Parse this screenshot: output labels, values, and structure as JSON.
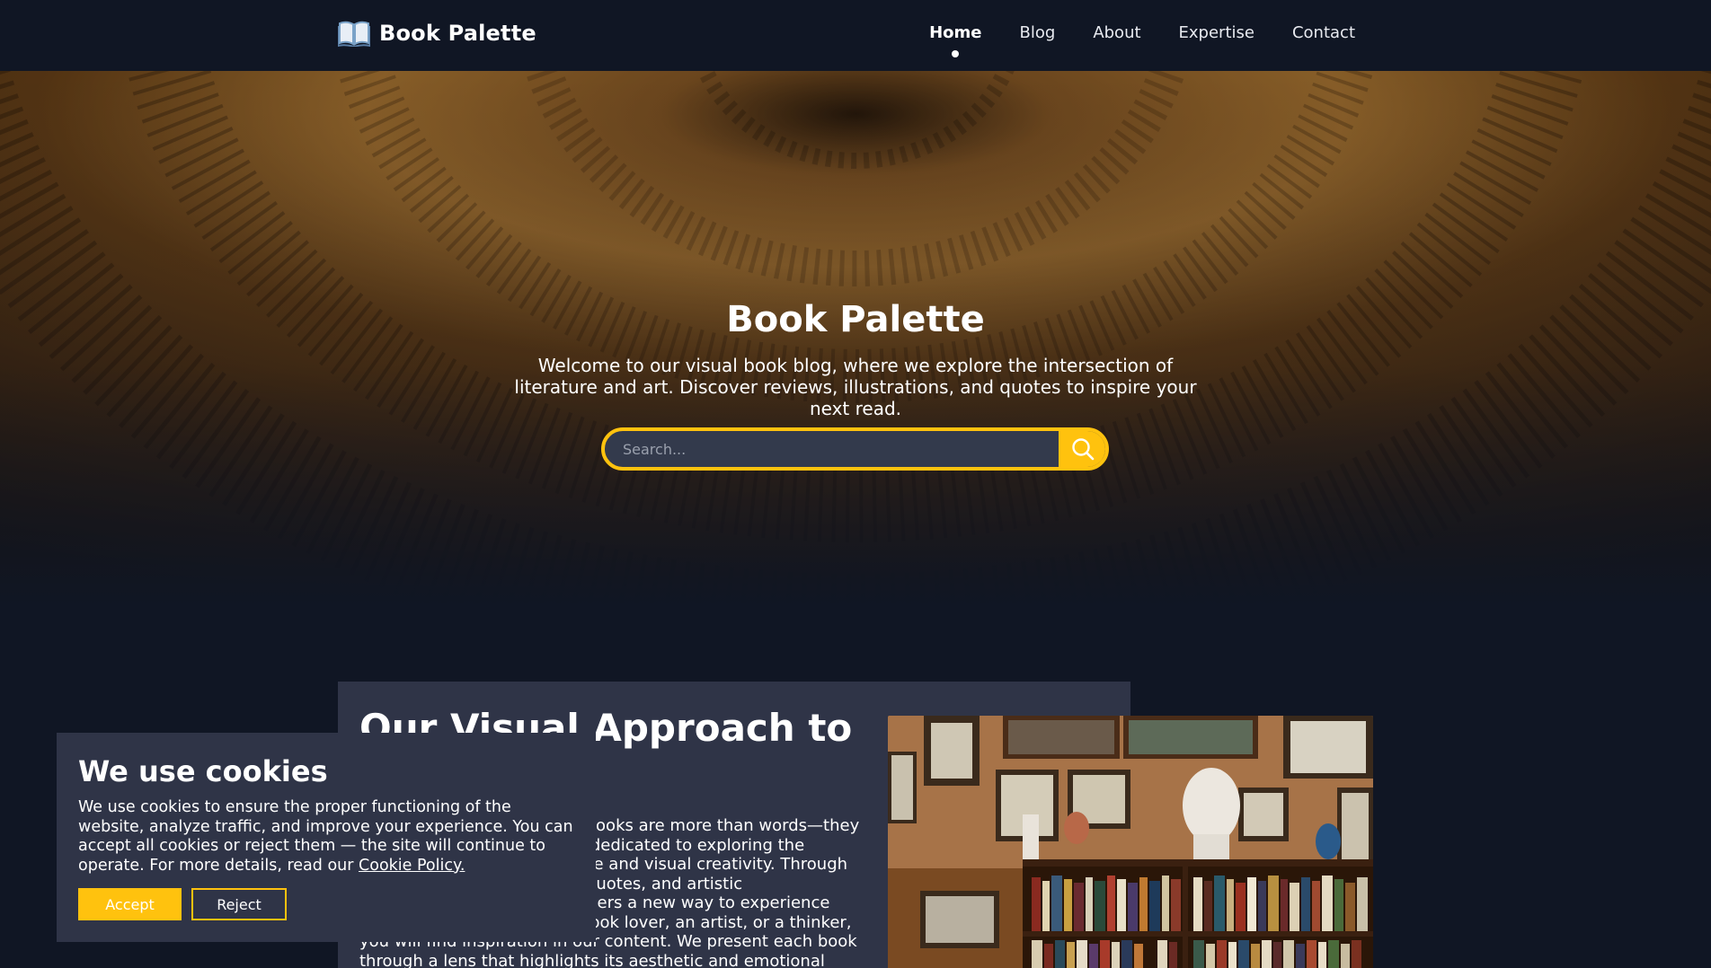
{
  "brand": {
    "name": "Book Palette",
    "logo_icon": "open-book-icon"
  },
  "nav": {
    "items": [
      {
        "label": "Home",
        "active": true
      },
      {
        "label": "Blog",
        "active": false
      },
      {
        "label": "About",
        "active": false
      },
      {
        "label": "Expertise",
        "active": false
      },
      {
        "label": "Contact",
        "active": false
      }
    ]
  },
  "hero": {
    "title": "Book Palette",
    "subtitle": "Welcome to our visual book blog, where we explore the intersection of literature and art. Discover reviews, illustrations, and quotes to inspire your next read.",
    "search_placeholder": "Search...",
    "search_icon": "search-icon"
  },
  "approach": {
    "title": "Our Visual Approach to",
    "text": "At Book Palette, we believe books are more than words—they are works of art. Our blog is dedicated to exploring the connection between literature and visual creativity. Through illustrated reviews, curated quotes, and artistic interpretations, we offer readers a new way to experience stories. Whether you are a book lover, an artist, or a thinker, you will find inspiration in our content. We present each book through a lens that highlights its aesthetic and emotional depth. Our goal is to"
  },
  "cookie": {
    "title": "We use cookies",
    "text": "We use cookies to ensure the proper functioning of the website, analyze traffic, and improve your experience. You can accept all cookies or reject them — the site will continue to operate. For more details, read our ",
    "link": "Cookie Policy.",
    "accept": "Accept",
    "reject": "Reject"
  },
  "colors": {
    "background": "#101624",
    "card": "#2f3447",
    "accent": "#ffc20e",
    "text": "#ffffff"
  }
}
